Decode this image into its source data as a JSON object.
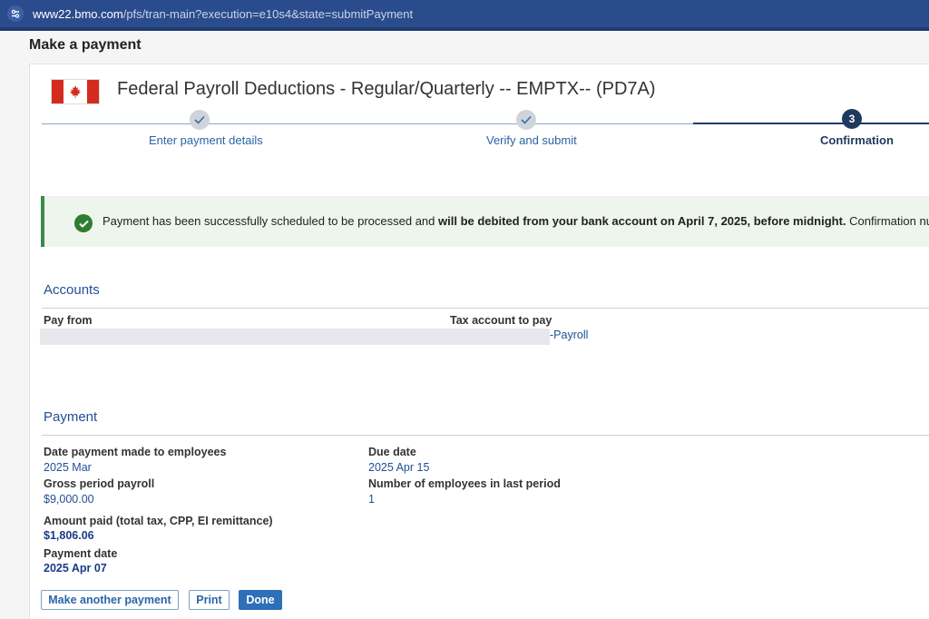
{
  "browser": {
    "url_host": "www22.bmo.com",
    "url_path": "/pfs/tran-main?execution=e10s4&state=submitPayment"
  },
  "page": {
    "title": "Make a payment"
  },
  "payee": {
    "title": "Federal Payroll Deductions - Regular/Quarterly -- EMPTX-- (PD7A)"
  },
  "steps": [
    {
      "label": "Enter payment details",
      "state": "complete"
    },
    {
      "label": "Verify and submit",
      "state": "complete"
    },
    {
      "label": "Confirmation",
      "state": "current",
      "number": "3"
    }
  ],
  "message": {
    "prefix": "Payment has been successfully scheduled to be processed and ",
    "bold": "will be debited from your bank account on April 7, 2025, before midnight.",
    "suffix": " Confirmation num"
  },
  "accounts": {
    "heading": "Accounts",
    "pay_from_label": "Pay from",
    "tax_account_label": "Tax account to pay",
    "tax_account_value": "-Payroll"
  },
  "payment": {
    "heading": "Payment",
    "date_made_label": "Date payment made to employees",
    "date_made_value": "2025 Mar",
    "due_date_label": "Due date",
    "due_date_value": "2025 Apr 15",
    "gross_label": "Gross period payroll",
    "gross_value": "$9,000.00",
    "employees_label": "Number of employees in last period",
    "employees_value": "1",
    "amount_label": "Amount paid (total tax, CPP, EI remittance)",
    "amount_value": "$1,806.06",
    "payment_date_label": "Payment date",
    "payment_date_value": "2025 Apr 07"
  },
  "buttons": {
    "another": "Make another payment",
    "print": "Print",
    "done": "Done"
  },
  "colors": {
    "link": "#2a64a8",
    "success": "#2e7d32",
    "primary": "#2d6fb8"
  }
}
